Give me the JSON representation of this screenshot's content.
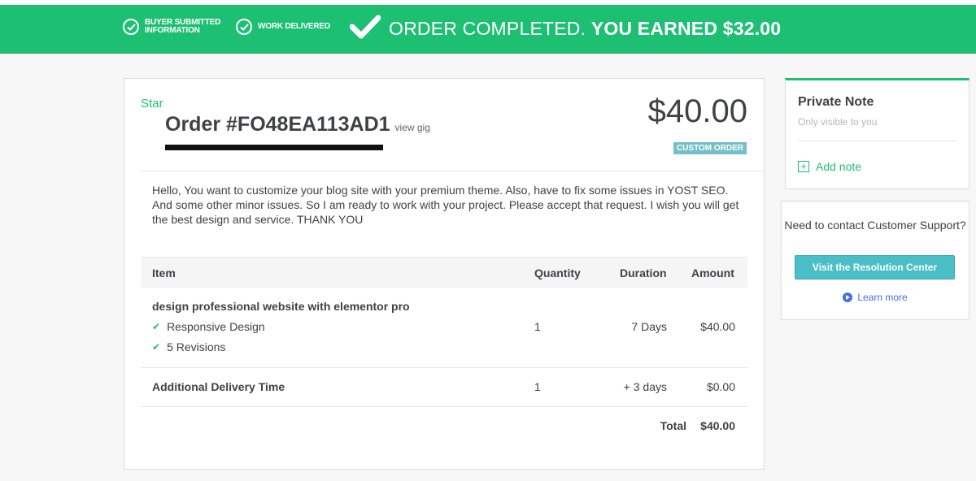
{
  "banner": {
    "step1_label": "BUYER SUBMITTED INFORMATION",
    "step2_label": "WORK DELIVERED",
    "completed_text": "ORDER COMPLETED.",
    "earned_text": "YOU EARNED $32.00",
    "color": "#1dbf73"
  },
  "order": {
    "tag": "Star",
    "title": "Order #FO48EA113AD1",
    "view_gig": "view gig",
    "price": "$40.00",
    "badge": "CUSTOM ORDER",
    "message": "Hello, You want to customize your blog site with your premium theme. Also, have to fix some issues in YOST SEO. And some other minor issues. So I am ready to work with your project. Please accept that request. I wish you will get the best design and service. THANK YOU"
  },
  "table": {
    "headers": {
      "item": "Item",
      "quantity": "Quantity",
      "duration": "Duration",
      "amount": "Amount"
    },
    "rows": [
      {
        "item": "design professional website with elementor pro",
        "features": [
          "Responsive Design",
          "5 Revisions"
        ],
        "quantity": "1",
        "duration": "7 Days",
        "amount": "$40.00"
      },
      {
        "item": "Additional Delivery Time",
        "quantity": "1",
        "duration": "+ 3 days",
        "amount": "$0.00"
      }
    ],
    "total_label": "Total",
    "total_value": "$40.00"
  },
  "private_note": {
    "title": "Private Note",
    "subtitle": "Only visible to you",
    "add_label": "Add note"
  },
  "support": {
    "question": "Need to contact Customer Support?",
    "button_label": "Visit the Resolution Center",
    "learn_more": "Learn more"
  }
}
